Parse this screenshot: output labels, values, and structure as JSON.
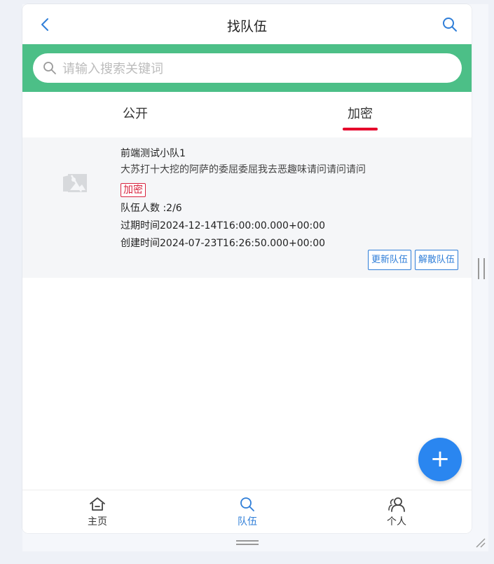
{
  "header": {
    "title": "找队伍"
  },
  "search": {
    "placeholder": "请输入搜索关键词"
  },
  "tabs": [
    {
      "label": "公开",
      "active": false
    },
    {
      "label": "加密",
      "active": true
    }
  ],
  "team": {
    "name": "前端测试小队1",
    "description": "大苏打十大挖的阿萨的委屈委屈我去恶趣味请问请问请问",
    "badge": "加密",
    "member_count": "队伍人数 :2/6",
    "expire_time": "过期时间2024-12-14T16:00:00.000+00:00",
    "create_time": "创建时间2024-07-23T16:26:50.000+00:00",
    "update_button": "更新队伍",
    "dismiss_button": "解散队伍"
  },
  "fab": {
    "label": "+"
  },
  "nav": [
    {
      "label": "主页",
      "icon": "home-icon",
      "active": false
    },
    {
      "label": "队伍",
      "icon": "search-icon",
      "active": true
    },
    {
      "label": "个人",
      "icon": "user-icon",
      "active": false
    }
  ],
  "colors": {
    "accent": "#2f7ed8",
    "search_band": "#4cbf87",
    "tab_indicator": "#e5002b",
    "badge": "#d8243f",
    "fab": "#2a86f0"
  }
}
